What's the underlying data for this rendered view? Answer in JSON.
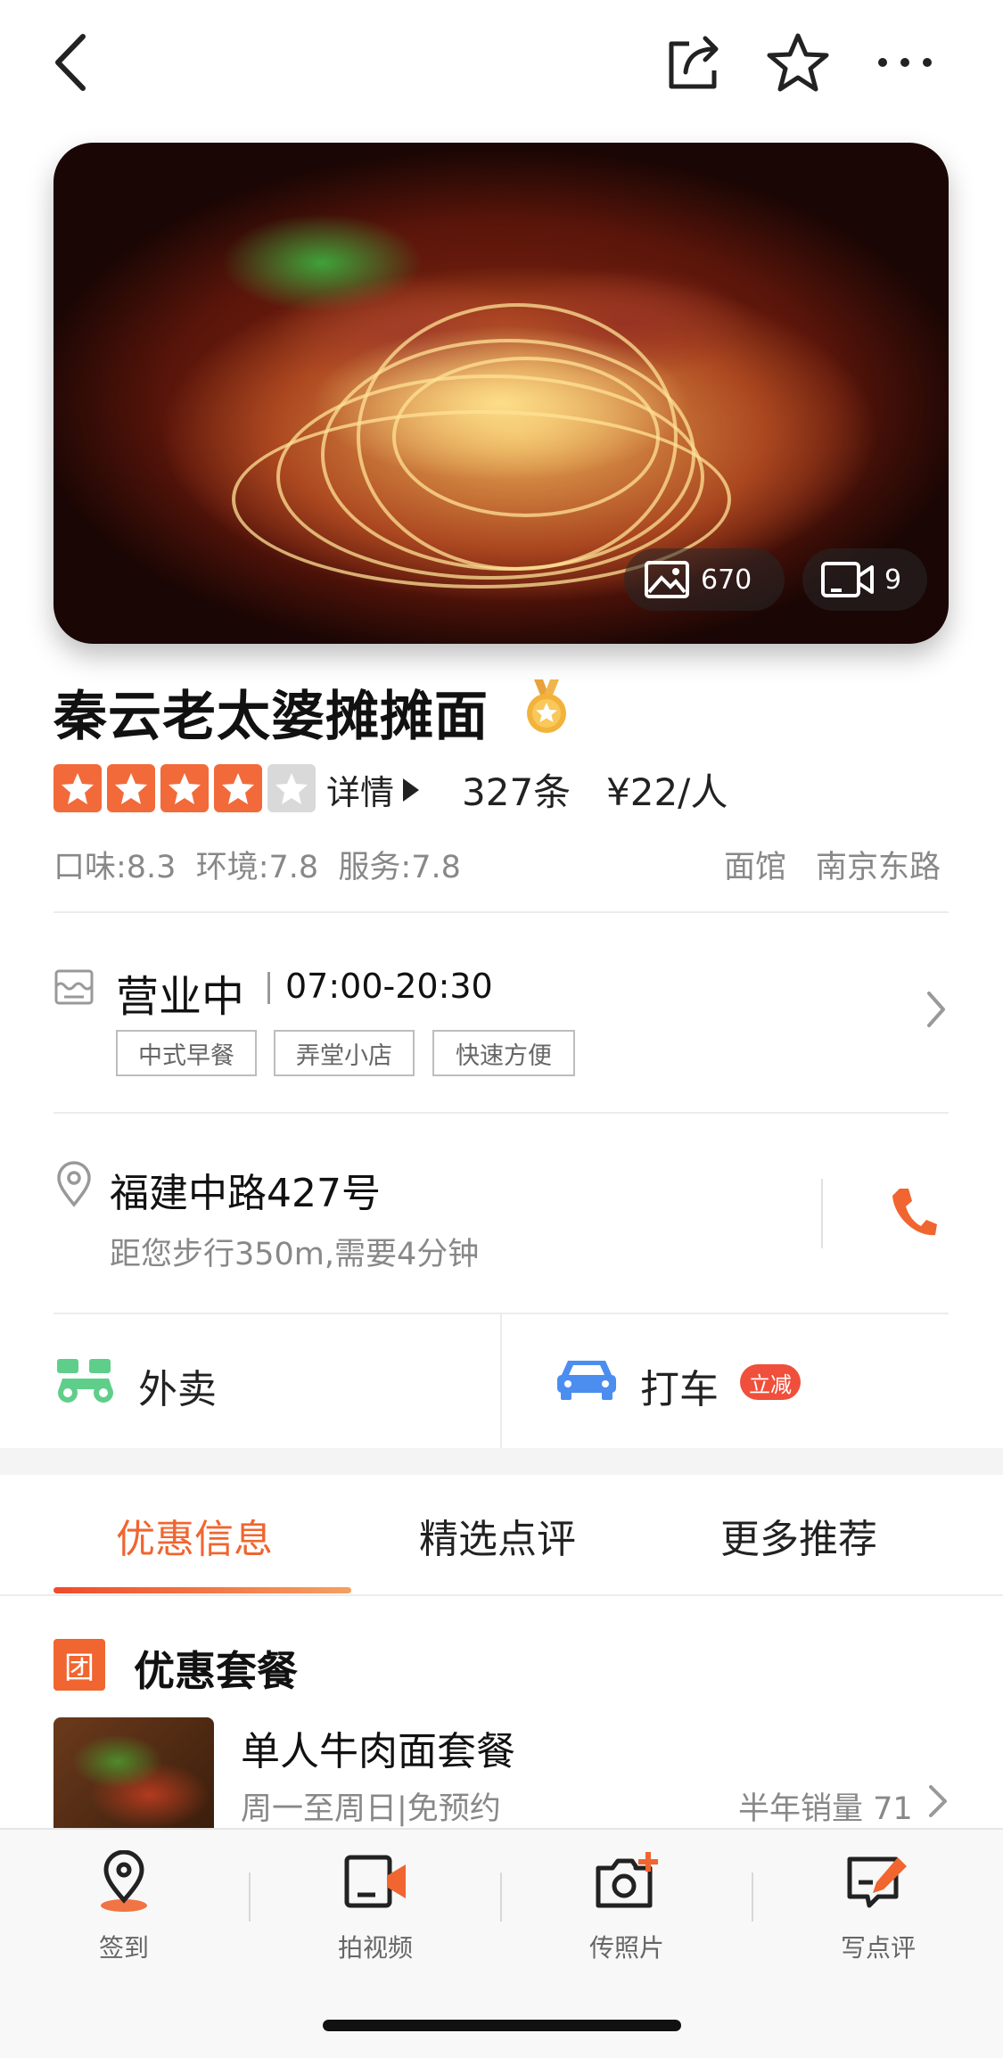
{
  "nav": {
    "back_icon": "chevron-left-icon",
    "share_icon": "share-icon",
    "favorite_icon": "star-outline-icon",
    "more_icon": "more-icon"
  },
  "hero": {
    "photo_count": "670",
    "video_count": "9"
  },
  "restaurant": {
    "name": "秦云老太婆摊摊面",
    "medal_icon": "gold-medal-icon",
    "rating_stars": 4,
    "rating_max": 5,
    "details_label": "详情",
    "review_count": "327条",
    "price": "¥22/人",
    "scores": "口味:8.3  环境:7.8  服务:7.8",
    "category": "面馆",
    "area": "南京东路"
  },
  "hours": {
    "status": "营业中",
    "time": "07:00-20:30",
    "tags": [
      "中式早餐",
      "弄堂小店",
      "快速方便"
    ]
  },
  "address": {
    "street": "福建中路427号",
    "distance": "距您步行350m,需要4分钟"
  },
  "services": {
    "delivery_label": "外卖",
    "taxi_label": "打车",
    "taxi_badge": "立减"
  },
  "tabs": [
    "优惠信息",
    "精选点评",
    "更多推荐"
  ],
  "deals": {
    "section_icon_text": "团",
    "section_title": "优惠套餐",
    "item": {
      "name": "单人牛肉面套餐",
      "subtitle": "周一至周日|免预约",
      "sales": "半年销量 71"
    }
  },
  "bottom_bar": [
    "签到",
    "拍视频",
    "传照片",
    "写点评"
  ],
  "colors": {
    "accent": "#f06530",
    "star": "#f26a3a",
    "star_empty": "#d9d9d9",
    "taxi": "#4b8ef0",
    "delivery": "#5fce8a"
  }
}
